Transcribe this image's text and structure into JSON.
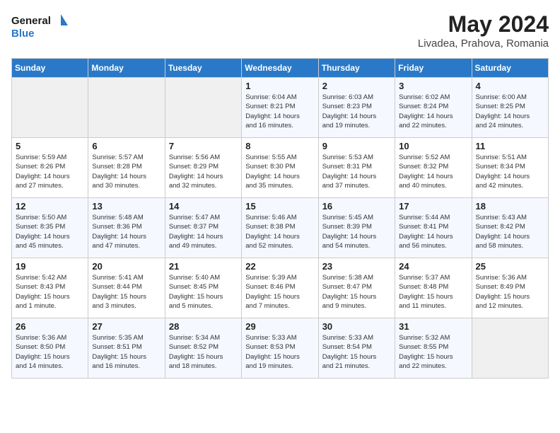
{
  "header": {
    "logo_line1": "General",
    "logo_line2": "Blue",
    "month": "May 2024",
    "location": "Livadea, Prahova, Romania"
  },
  "weekdays": [
    "Sunday",
    "Monday",
    "Tuesday",
    "Wednesday",
    "Thursday",
    "Friday",
    "Saturday"
  ],
  "weeks": [
    [
      {
        "day": "",
        "info": ""
      },
      {
        "day": "",
        "info": ""
      },
      {
        "day": "",
        "info": ""
      },
      {
        "day": "1",
        "info": "Sunrise: 6:04 AM\nSunset: 8:21 PM\nDaylight: 14 hours\nand 16 minutes."
      },
      {
        "day": "2",
        "info": "Sunrise: 6:03 AM\nSunset: 8:23 PM\nDaylight: 14 hours\nand 19 minutes."
      },
      {
        "day": "3",
        "info": "Sunrise: 6:02 AM\nSunset: 8:24 PM\nDaylight: 14 hours\nand 22 minutes."
      },
      {
        "day": "4",
        "info": "Sunrise: 6:00 AM\nSunset: 8:25 PM\nDaylight: 14 hours\nand 24 minutes."
      }
    ],
    [
      {
        "day": "5",
        "info": "Sunrise: 5:59 AM\nSunset: 8:26 PM\nDaylight: 14 hours\nand 27 minutes."
      },
      {
        "day": "6",
        "info": "Sunrise: 5:57 AM\nSunset: 8:28 PM\nDaylight: 14 hours\nand 30 minutes."
      },
      {
        "day": "7",
        "info": "Sunrise: 5:56 AM\nSunset: 8:29 PM\nDaylight: 14 hours\nand 32 minutes."
      },
      {
        "day": "8",
        "info": "Sunrise: 5:55 AM\nSunset: 8:30 PM\nDaylight: 14 hours\nand 35 minutes."
      },
      {
        "day": "9",
        "info": "Sunrise: 5:53 AM\nSunset: 8:31 PM\nDaylight: 14 hours\nand 37 minutes."
      },
      {
        "day": "10",
        "info": "Sunrise: 5:52 AM\nSunset: 8:32 PM\nDaylight: 14 hours\nand 40 minutes."
      },
      {
        "day": "11",
        "info": "Sunrise: 5:51 AM\nSunset: 8:34 PM\nDaylight: 14 hours\nand 42 minutes."
      }
    ],
    [
      {
        "day": "12",
        "info": "Sunrise: 5:50 AM\nSunset: 8:35 PM\nDaylight: 14 hours\nand 45 minutes."
      },
      {
        "day": "13",
        "info": "Sunrise: 5:48 AM\nSunset: 8:36 PM\nDaylight: 14 hours\nand 47 minutes."
      },
      {
        "day": "14",
        "info": "Sunrise: 5:47 AM\nSunset: 8:37 PM\nDaylight: 14 hours\nand 49 minutes."
      },
      {
        "day": "15",
        "info": "Sunrise: 5:46 AM\nSunset: 8:38 PM\nDaylight: 14 hours\nand 52 minutes."
      },
      {
        "day": "16",
        "info": "Sunrise: 5:45 AM\nSunset: 8:39 PM\nDaylight: 14 hours\nand 54 minutes."
      },
      {
        "day": "17",
        "info": "Sunrise: 5:44 AM\nSunset: 8:41 PM\nDaylight: 14 hours\nand 56 minutes."
      },
      {
        "day": "18",
        "info": "Sunrise: 5:43 AM\nSunset: 8:42 PM\nDaylight: 14 hours\nand 58 minutes."
      }
    ],
    [
      {
        "day": "19",
        "info": "Sunrise: 5:42 AM\nSunset: 8:43 PM\nDaylight: 15 hours\nand 1 minute."
      },
      {
        "day": "20",
        "info": "Sunrise: 5:41 AM\nSunset: 8:44 PM\nDaylight: 15 hours\nand 3 minutes."
      },
      {
        "day": "21",
        "info": "Sunrise: 5:40 AM\nSunset: 8:45 PM\nDaylight: 15 hours\nand 5 minutes."
      },
      {
        "day": "22",
        "info": "Sunrise: 5:39 AM\nSunset: 8:46 PM\nDaylight: 15 hours\nand 7 minutes."
      },
      {
        "day": "23",
        "info": "Sunrise: 5:38 AM\nSunset: 8:47 PM\nDaylight: 15 hours\nand 9 minutes."
      },
      {
        "day": "24",
        "info": "Sunrise: 5:37 AM\nSunset: 8:48 PM\nDaylight: 15 hours\nand 11 minutes."
      },
      {
        "day": "25",
        "info": "Sunrise: 5:36 AM\nSunset: 8:49 PM\nDaylight: 15 hours\nand 12 minutes."
      }
    ],
    [
      {
        "day": "26",
        "info": "Sunrise: 5:36 AM\nSunset: 8:50 PM\nDaylight: 15 hours\nand 14 minutes."
      },
      {
        "day": "27",
        "info": "Sunrise: 5:35 AM\nSunset: 8:51 PM\nDaylight: 15 hours\nand 16 minutes."
      },
      {
        "day": "28",
        "info": "Sunrise: 5:34 AM\nSunset: 8:52 PM\nDaylight: 15 hours\nand 18 minutes."
      },
      {
        "day": "29",
        "info": "Sunrise: 5:33 AM\nSunset: 8:53 PM\nDaylight: 15 hours\nand 19 minutes."
      },
      {
        "day": "30",
        "info": "Sunrise: 5:33 AM\nSunset: 8:54 PM\nDaylight: 15 hours\nand 21 minutes."
      },
      {
        "day": "31",
        "info": "Sunrise: 5:32 AM\nSunset: 8:55 PM\nDaylight: 15 hours\nand 22 minutes."
      },
      {
        "day": "",
        "info": ""
      }
    ]
  ]
}
